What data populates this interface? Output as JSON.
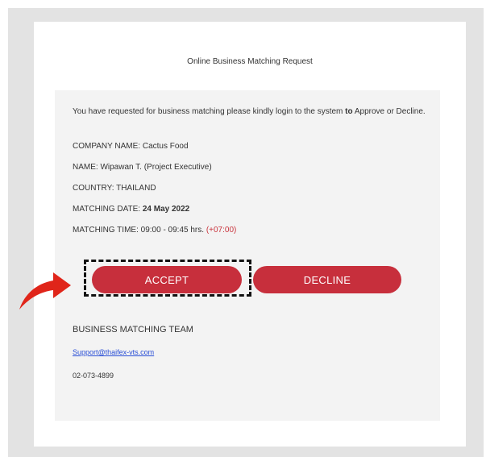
{
  "email": {
    "header": "Online Business Matching Request",
    "intro_part1": "You have requested for business matching please kindly login to the system ",
    "intro_bold": "to",
    "intro_part2": " Approve or Decline.",
    "company": "COMPANY NAME: Cactus Food",
    "name": "NAME: Wipawan T. (Project Executive)",
    "country": "COUNTRY: THAILAND",
    "matching_date_label": "MATCHING DATE: ",
    "matching_date_value": "24 May 2022",
    "matching_time_label": "MATCHING TIME:  ",
    "matching_time_value": "09:00 - 09:45 hrs.",
    "matching_time_tz": "(+07:00)",
    "accept_label": "ACCEPT",
    "decline_label": "DECLINE",
    "team": "BUSINESS MATCHING TEAM",
    "support_email": "Support@thaifex-vts.com",
    "phone": "02-073-4899"
  },
  "colors": {
    "button": "#c72f3c",
    "arrow": "#e0251a",
    "timezone": "#c9343d",
    "link": "#2a4fd6"
  },
  "icons": {
    "pointer_arrow": "curved-red-arrow-icon"
  }
}
